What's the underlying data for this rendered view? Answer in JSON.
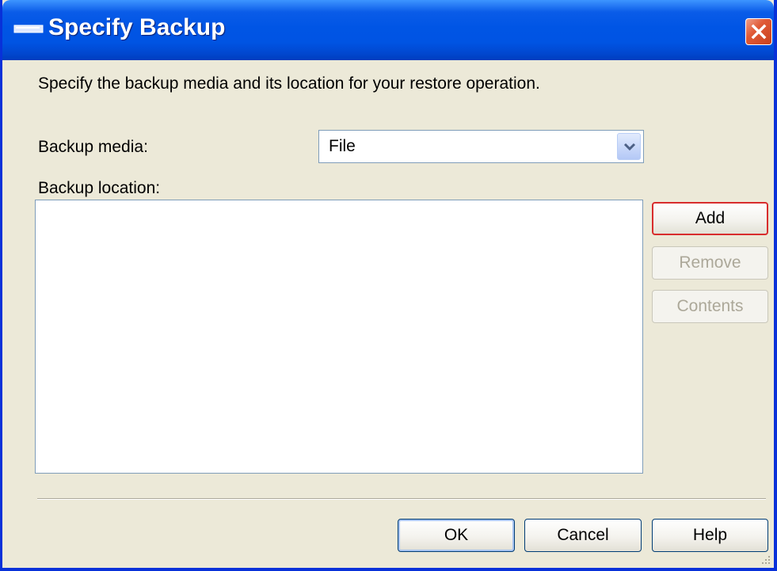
{
  "window": {
    "title": "Specify Backup",
    "close_label": "×"
  },
  "description": "Specify the backup media and its location for your restore operation.",
  "backup_media": {
    "label": "Backup media:",
    "value": "File"
  },
  "backup_location": {
    "label": "Backup location:",
    "items": []
  },
  "side_buttons": {
    "add": "Add",
    "remove": "Remove",
    "contents": "Contents"
  },
  "footer_buttons": {
    "ok": "OK",
    "cancel": "Cancel",
    "help": "Help"
  },
  "icons": {
    "title": "dialog-bar-icon",
    "close": "close-icon",
    "dropdown": "chevron-down-icon",
    "grip": "resize-grip-icon"
  },
  "colors": {
    "titlebar": "#0054e3",
    "window_border": "#0831d9",
    "dialog_bg": "#ece9d8",
    "close_button": "#e05a36",
    "default_button_border": "#d82d2d",
    "disabled_text": "#aca899"
  }
}
